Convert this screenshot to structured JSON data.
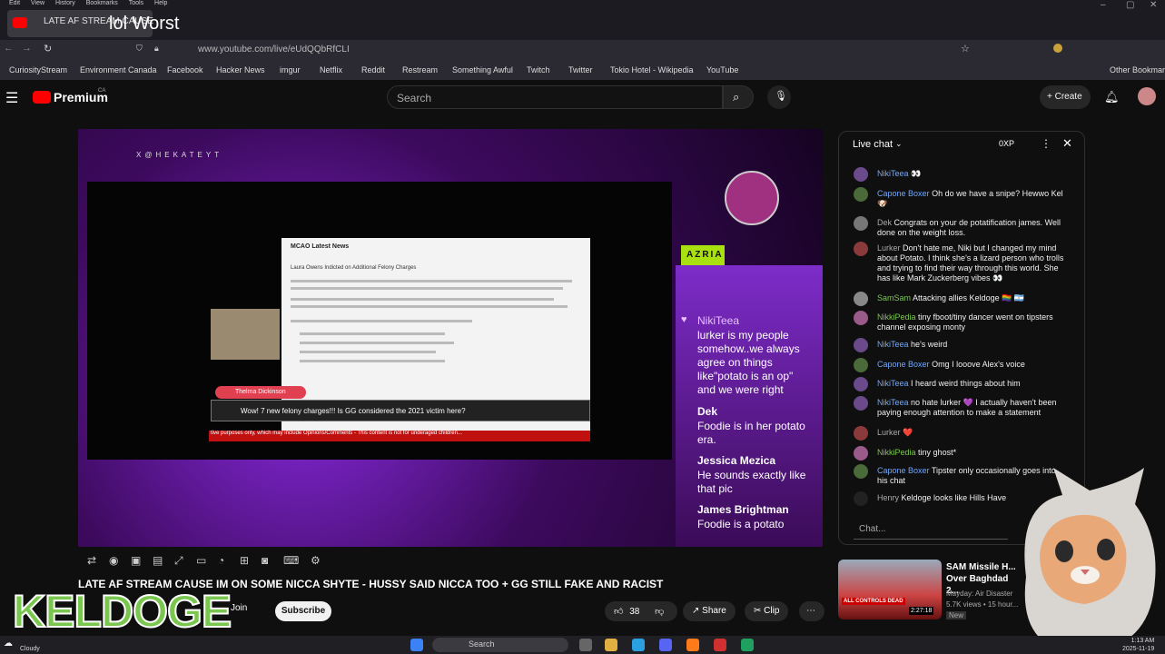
{
  "browser": {
    "menu": [
      "Edit",
      "View",
      "History",
      "Bookmarks",
      "Tools",
      "Help"
    ],
    "tab_title": "LATE AF STREAM CAUSE",
    "window_title": "lol Worst",
    "url": "www.youtube.com/live/eUdQQbRfCLI",
    "bookmarks": [
      "CuriosityStream",
      "Environment Canada",
      "Facebook",
      "Hacker News",
      "imgur",
      "Netflix",
      "Reddit",
      "Restream",
      "Something Awful",
      "Twitch",
      "Twitter",
      "Tokio Hotel - Wikipedia",
      "YouTube"
    ],
    "other_bookmarks": "Other Bookmarks"
  },
  "youtube": {
    "logo": "Premium",
    "country": "CA",
    "search_placeholder": "Search",
    "create_label": "Create"
  },
  "video": {
    "watermark": "X@HEKATEYT",
    "azria_label": "AZRIA",
    "article_title": "MCAO Latest News",
    "article_headline": "Laura Owens Indicted on Additional Felony Charges",
    "donor": "Thelma Dickinson",
    "donation_msg": "Wow! 7 new felony charges!!! Is GG considered the 2021 victim here?",
    "ticker": "tive purposes only, which may include Opinions/Comments - This content is not for underaged children...",
    "overlay_chat": [
      {
        "name": "NikiTeea",
        "text": "lurker is my people somehow..we always agree on things like\"potato is an op\" and we were right"
      },
      {
        "name": "Dek",
        "text": "Foodie is in her potato era."
      },
      {
        "name": "Jessica Mezica",
        "text": "He sounds exactly like that pic"
      },
      {
        "name": "James Brightman",
        "text": "Foodie is a potato"
      }
    ],
    "title": "LATE AF STREAM CAUSE IM ON SOME NICCA SHYTE - HUSSY SAID NICCA TOO + GG STILL FAKE AND RACIST",
    "channel_overlay": "KELDOGE",
    "join": "Join",
    "subscribe": "Subscribe",
    "likes": "38",
    "share": "Share",
    "clip": "Clip"
  },
  "live_chat": {
    "header": "Live chat",
    "points": "0XP",
    "messages": [
      {
        "name": "NikiTeea",
        "text": "👀",
        "color": "#6fa8ff"
      },
      {
        "name": "Capone Boxer",
        "text": "Oh do we have a snipe? Hewwo Kel 🐶",
        "color": "#6fa8ff"
      },
      {
        "name": "Dek",
        "text": "Congrats on your de potatification james. Well done on the weight loss.",
        "color": "#aaaaaa"
      },
      {
        "name": "Lurker",
        "text": "Don't hate me, Niki but I changed my mind about Potato. I think she's a lizard person who trolls and trying to find their way through this world. She has like Mark Zuckerberg vibes 👀",
        "color": "#aaaaaa"
      },
      {
        "name": "SamSam",
        "text": "Attacking allies Keldoge 🏳️‍🌈 🇦🇷",
        "color": "#7ac74f"
      },
      {
        "name": "NikkiPedia",
        "text": "tiny fboot/tiny dancer went on tipsters channel exposing monty",
        "color": "#7ac74f"
      },
      {
        "name": "NikiTeea",
        "text": "he's weird",
        "color": "#6fa8ff"
      },
      {
        "name": "Capone Boxer",
        "text": "Omg I looove Alex's voice",
        "color": "#6fa8ff"
      },
      {
        "name": "NikiTeea",
        "text": "I heard weird things about him",
        "color": "#6fa8ff"
      },
      {
        "name": "NikiTeea",
        "text": "no hate lurker 💜 I actually haven't been paying enough attention to make a statement",
        "color": "#6fa8ff"
      },
      {
        "name": "Lurker",
        "text": "❤️",
        "color": "#aaaaaa"
      },
      {
        "name": "NikkiPedia",
        "text": "tiny ghost*",
        "color": "#7ac74f"
      },
      {
        "name": "Capone Boxer",
        "text": "Tipster only occasionally goes into his chat",
        "color": "#6fa8ff"
      },
      {
        "name": "Henry",
        "text": "Keldoge looks like Hills Have",
        "color": "#aaaaaa"
      }
    ],
    "input_placeholder": "Chat..."
  },
  "recommendation": {
    "title": "SAM Missile H... Over Baghdad 2...",
    "channel": "Mayday: Air Disaster",
    "views": "5.7K views • 15 hour...",
    "badge": "New",
    "duration": "2:27:18",
    "thumb_text": "ALL CONTROLS DEAD"
  },
  "taskbar": {
    "weather": "Cloudy",
    "search": "Search",
    "time": "1:13 AM",
    "date": "2025-11-19"
  }
}
